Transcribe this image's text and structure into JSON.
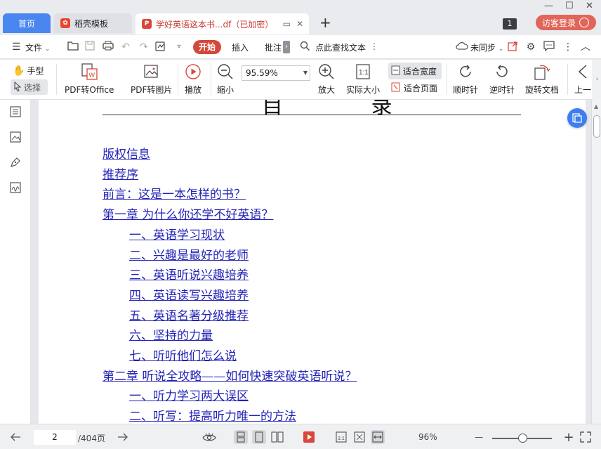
{
  "titlebar": {
    "tabs": [
      {
        "label": "首页",
        "icon": "home"
      },
      {
        "label": "稻壳模板",
        "icon": "daoke-logo-icon"
      },
      {
        "label": "学好英语这本书...df（已加密）",
        "icon": "pdf-icon"
      }
    ],
    "doc_count_badge": "1",
    "visitor_login": "访客登录"
  },
  "menubar": {
    "file": "文件",
    "start": "开始",
    "insert": "插入",
    "annotate": "批注",
    "search": "点此查找文本",
    "sync": "未同步"
  },
  "ribbon": {
    "hand": "手型",
    "select": "选择",
    "pdf_to_office": "PDF转Office",
    "pdf_to_image": "PDF转图片",
    "play": "播放",
    "zoom_out": "缩小",
    "zoom_value": "95.59%",
    "zoom_in": "放大",
    "actual_size": "实际大小",
    "fit_width": "适合宽度",
    "fit_page": "适合页面",
    "rotate_cw": "顺时针",
    "rotate_ccw": "逆时针",
    "rotate_doc": "旋转文档",
    "prev": "上一"
  },
  "document": {
    "toc_title": "目 录",
    "entries": [
      {
        "text": "版权信息",
        "level": 1
      },
      {
        "text": "推荐序",
        "level": 1
      },
      {
        "text": "前言：这是一本怎样的书？",
        "level": 1
      },
      {
        "text": "第一章 为什么你还学不好英语？",
        "level": 1
      },
      {
        "text": "一、英语学习现状",
        "level": 2
      },
      {
        "text": "二、兴趣是最好的老师",
        "level": 2
      },
      {
        "text": "三、英语听说兴趣培养",
        "level": 2
      },
      {
        "text": "四、英语读写兴趣培养",
        "level": 2
      },
      {
        "text": "五、英语名著分级推荐",
        "level": 2
      },
      {
        "text": "六、坚持的力量",
        "level": 2
      },
      {
        "text": "七、听听他们怎么说",
        "level": 2
      },
      {
        "text": "第二章 听说全攻略——如何快速突破英语听说？",
        "level": 1
      },
      {
        "text": "一、听力学习两大误区",
        "level": 2
      },
      {
        "text": "二、听写：提高听力唯一的方法",
        "level": 2
      }
    ]
  },
  "statusbar": {
    "current_page": "2",
    "total_pages": "/404页",
    "zoom": "96%",
    "zoom_level": 0.5
  },
  "colors": {
    "accent_blue": "#4a86f0",
    "brand_red": "#d3483b",
    "link": "#2323b8"
  }
}
